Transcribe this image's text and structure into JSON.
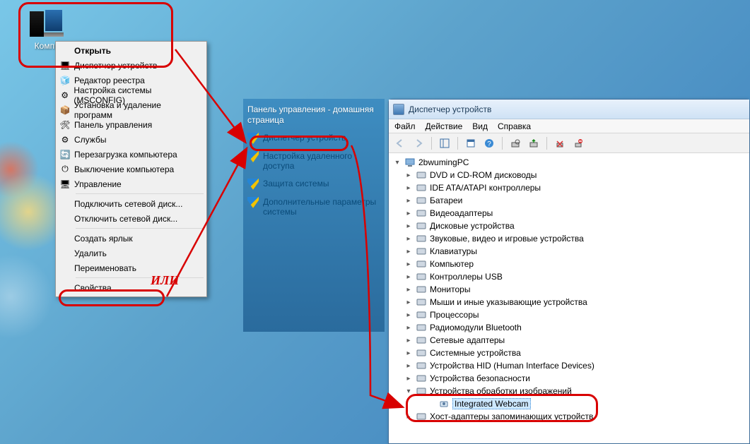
{
  "desktop": {
    "icon_label": "Компь"
  },
  "context_menu": {
    "items": [
      {
        "label": "Открыть",
        "bold": true,
        "icon": ""
      },
      {
        "label": "Диспетчер устройств",
        "icon": "device-manager-icon"
      },
      {
        "label": "Редактор реестра",
        "icon": "registry-icon"
      },
      {
        "label": "Настройка системы (MSCONFIG)",
        "icon": "msconfig-icon"
      },
      {
        "label": "Установка и удаление программ",
        "icon": "programs-icon"
      },
      {
        "label": "Панель управления",
        "icon": "control-panel-icon"
      },
      {
        "label": "Службы",
        "icon": "services-icon"
      },
      {
        "label": "Перезагрузка компьютера",
        "icon": "restart-icon"
      },
      {
        "label": "Выключение компьютера",
        "icon": "shutdown-icon"
      },
      {
        "label": "Управление",
        "icon": "manage-icon"
      },
      {
        "sep": true
      },
      {
        "label": "Подключить сетевой диск...",
        "icon": ""
      },
      {
        "label": "Отключить сетевой диск...",
        "icon": ""
      },
      {
        "sep": true
      },
      {
        "label": "Создать ярлык",
        "icon": ""
      },
      {
        "label": "Удалить",
        "icon": ""
      },
      {
        "label": "Переименовать",
        "icon": ""
      },
      {
        "sep": true
      },
      {
        "label": "Свойства",
        "icon": ""
      }
    ]
  },
  "control_panel": {
    "section_title": "Панель управления - домашняя страница",
    "items": [
      {
        "label": "Диспетчер устройств"
      },
      {
        "label": "Настройка удаленного доступа"
      },
      {
        "label": "Защита системы"
      },
      {
        "label": "Дополнительные параметры системы"
      }
    ]
  },
  "devmgr": {
    "title": "Диспетчер устройств",
    "menus": {
      "file": "Файл",
      "action": "Действие",
      "view": "Вид",
      "help": "Справка"
    },
    "root": "2bwumingPC",
    "nodes": [
      {
        "label": "DVD и CD-ROM дисководы"
      },
      {
        "label": "IDE ATA/ATAPI контроллеры"
      },
      {
        "label": "Батареи"
      },
      {
        "label": "Видеоадаптеры"
      },
      {
        "label": "Дисковые устройства"
      },
      {
        "label": "Звуковые, видео и игровые устройства"
      },
      {
        "label": "Клавиатуры"
      },
      {
        "label": "Компьютер"
      },
      {
        "label": "Контроллеры USB"
      },
      {
        "label": "Мониторы"
      },
      {
        "label": "Мыши и иные указывающие устройства"
      },
      {
        "label": "Процессоры"
      },
      {
        "label": "Радиомодули Bluetooth"
      },
      {
        "label": "Сетевые адаптеры"
      },
      {
        "label": "Системные устройства"
      },
      {
        "label": "Устройства HID (Human Interface Devices)"
      },
      {
        "label": "Устройства безопасности"
      },
      {
        "label": "Устройства обработки изображений",
        "expanded": true,
        "children": [
          {
            "label": "Integrated Webcam",
            "selected": true
          }
        ]
      },
      {
        "label": "Хост-адаптеры запоминающих устройств"
      }
    ]
  },
  "annotations": {
    "or_text": "ИЛИ"
  }
}
